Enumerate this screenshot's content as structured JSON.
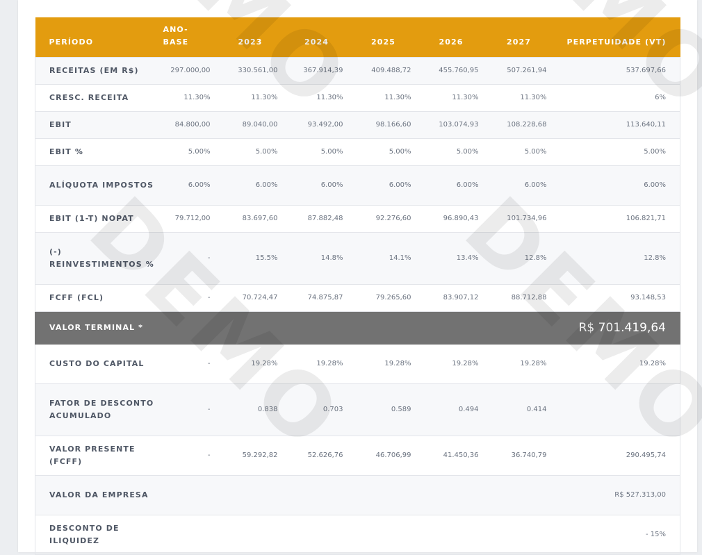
{
  "table": {
    "headers": [
      "PERÍODO",
      "ANO-BASE",
      "2023",
      "2024",
      "2025",
      "2026",
      "2027",
      "PERPETUIDADE (VT)"
    ],
    "rows": [
      {
        "label": "RECEITAS (EM R$)",
        "values": [
          "297.000,00",
          "330.561,00",
          "367.914,39",
          "409.488,72",
          "455.760,95",
          "507.261,94",
          "537.697,66"
        ]
      },
      {
        "label": "CRESC. RECEITA",
        "values": [
          "11.30%",
          "11.30%",
          "11.30%",
          "11.30%",
          "11.30%",
          "11.30%",
          "6%"
        ]
      },
      {
        "label": "EBIT",
        "values": [
          "84.800,00",
          "89.040,00",
          "93.492,00",
          "98.166,60",
          "103.074,93",
          "108.228,68",
          "113.640,11"
        ]
      },
      {
        "label": "EBIT %",
        "values": [
          "5.00%",
          "5.00%",
          "5.00%",
          "5.00%",
          "5.00%",
          "5.00%",
          "5.00%"
        ]
      },
      {
        "label": "ALÍQUOTA IMPOSTOS",
        "values": [
          "6.00%",
          "6.00%",
          "6.00%",
          "6.00%",
          "6.00%",
          "6.00%",
          "6.00%"
        ]
      },
      {
        "label": "EBIT (1-T) NOPAT",
        "values": [
          "79.712,00",
          "83.697,60",
          "87.882,48",
          "92.276,60",
          "96.890,43",
          "101.734,96",
          "106.821,71"
        ]
      },
      {
        "label": "(-) REINVESTIMENTOS %",
        "values": [
          "-",
          "15.5%",
          "14.8%",
          "14.1%",
          "13.4%",
          "12.8%",
          "12.8%"
        ]
      },
      {
        "label": "FCFF (FCL)",
        "values": [
          "-",
          "70.724,47",
          "74.875,87",
          "79.265,60",
          "83.907,12",
          "88.712,88",
          "93.148,53"
        ]
      }
    ],
    "terminal": {
      "label": "VALOR TERMINAL *",
      "value": "R$ 701.419,64"
    },
    "rows2": [
      {
        "label": "CUSTO DO CAPITAL",
        "values": [
          "-",
          "19.28%",
          "19.28%",
          "19.28%",
          "19.28%",
          "19.28%",
          "19.28%"
        ]
      },
      {
        "label": "FATOR DE DESCONTO ACUMULADO",
        "values": [
          "-",
          "0.838",
          "0.703",
          "0.589",
          "0.494",
          "0.414",
          ""
        ]
      },
      {
        "label": "VALOR PRESENTE (FCFF)",
        "values": [
          "-",
          "59.292,82",
          "52.626,76",
          "46.706,99",
          "41.450,36",
          "36.740,79",
          "290.495,74"
        ]
      },
      {
        "label": "VALOR DA EMPRESA",
        "values": [
          "",
          "",
          "",
          "",
          "",
          "",
          "R$ 527.313,00"
        ]
      },
      {
        "label": "DESCONTO DE ILIQUIDEZ",
        "values": [
          "",
          "",
          "",
          "",
          "",
          "",
          "- 15%"
        ]
      }
    ]
  },
  "watermark": "DEMO"
}
